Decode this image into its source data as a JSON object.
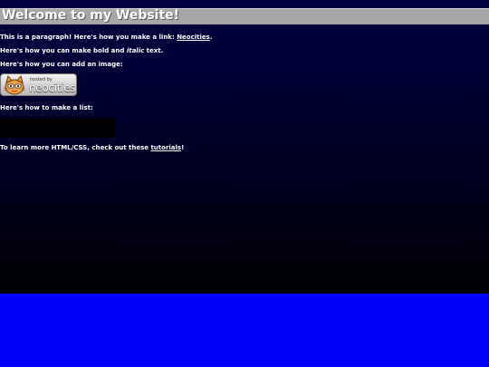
{
  "header": {
    "title": "Welcome to my Website!"
  },
  "content": {
    "para1_text": "This is a paragraph! Here's how you make a link: ",
    "para1_link": "Neocities",
    "para1_end": ".",
    "para2_start": "Here's how you can make bold and ",
    "para2_italic": "italic",
    "para2_end": " text.",
    "para3_text": "Here's how you can add an image:",
    "badge": {
      "small_text": "hosted by",
      "big_text": "neocities",
      "icon": "neocities-cat-icon"
    },
    "para4_text": "Here's how to make a list:",
    "para5_text": "To learn more HTML/CSS, check out these ",
    "para5_link": "tutorials",
    "para5_end": "!"
  },
  "colors": {
    "page_bg": "#0000ff",
    "header_bg": "#a7a7a7",
    "text": "#ffffff"
  }
}
